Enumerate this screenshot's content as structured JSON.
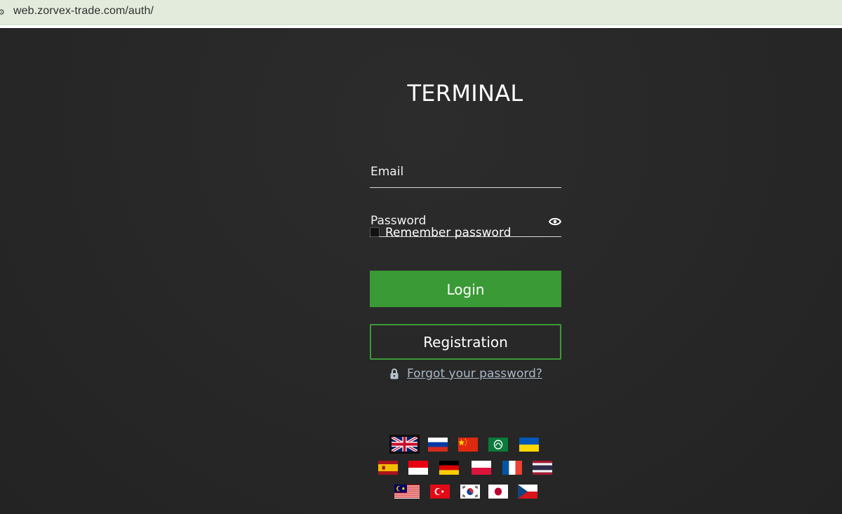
{
  "browser": {
    "url": "web.zorvex-trade.com/auth/"
  },
  "page": {
    "title": "TERMINAL",
    "email_placeholder": "Email",
    "password_placeholder": "Password",
    "remember_label": "Remember password",
    "login_label": "Login",
    "registration_label": "Registration",
    "forgot_label": "Forgot your password?"
  },
  "languages": {
    "selected": "en",
    "rows": [
      [
        "en",
        "ru",
        "zh",
        "ar",
        "uk"
      ],
      [
        "es",
        "id",
        "de",
        "pl",
        "fr",
        "th"
      ],
      [
        "ms",
        "tr",
        "ko",
        "ja",
        "cs"
      ]
    ]
  },
  "colors": {
    "accent": "#3a9a35",
    "link": "#a9b7c6",
    "background": "#272727"
  }
}
